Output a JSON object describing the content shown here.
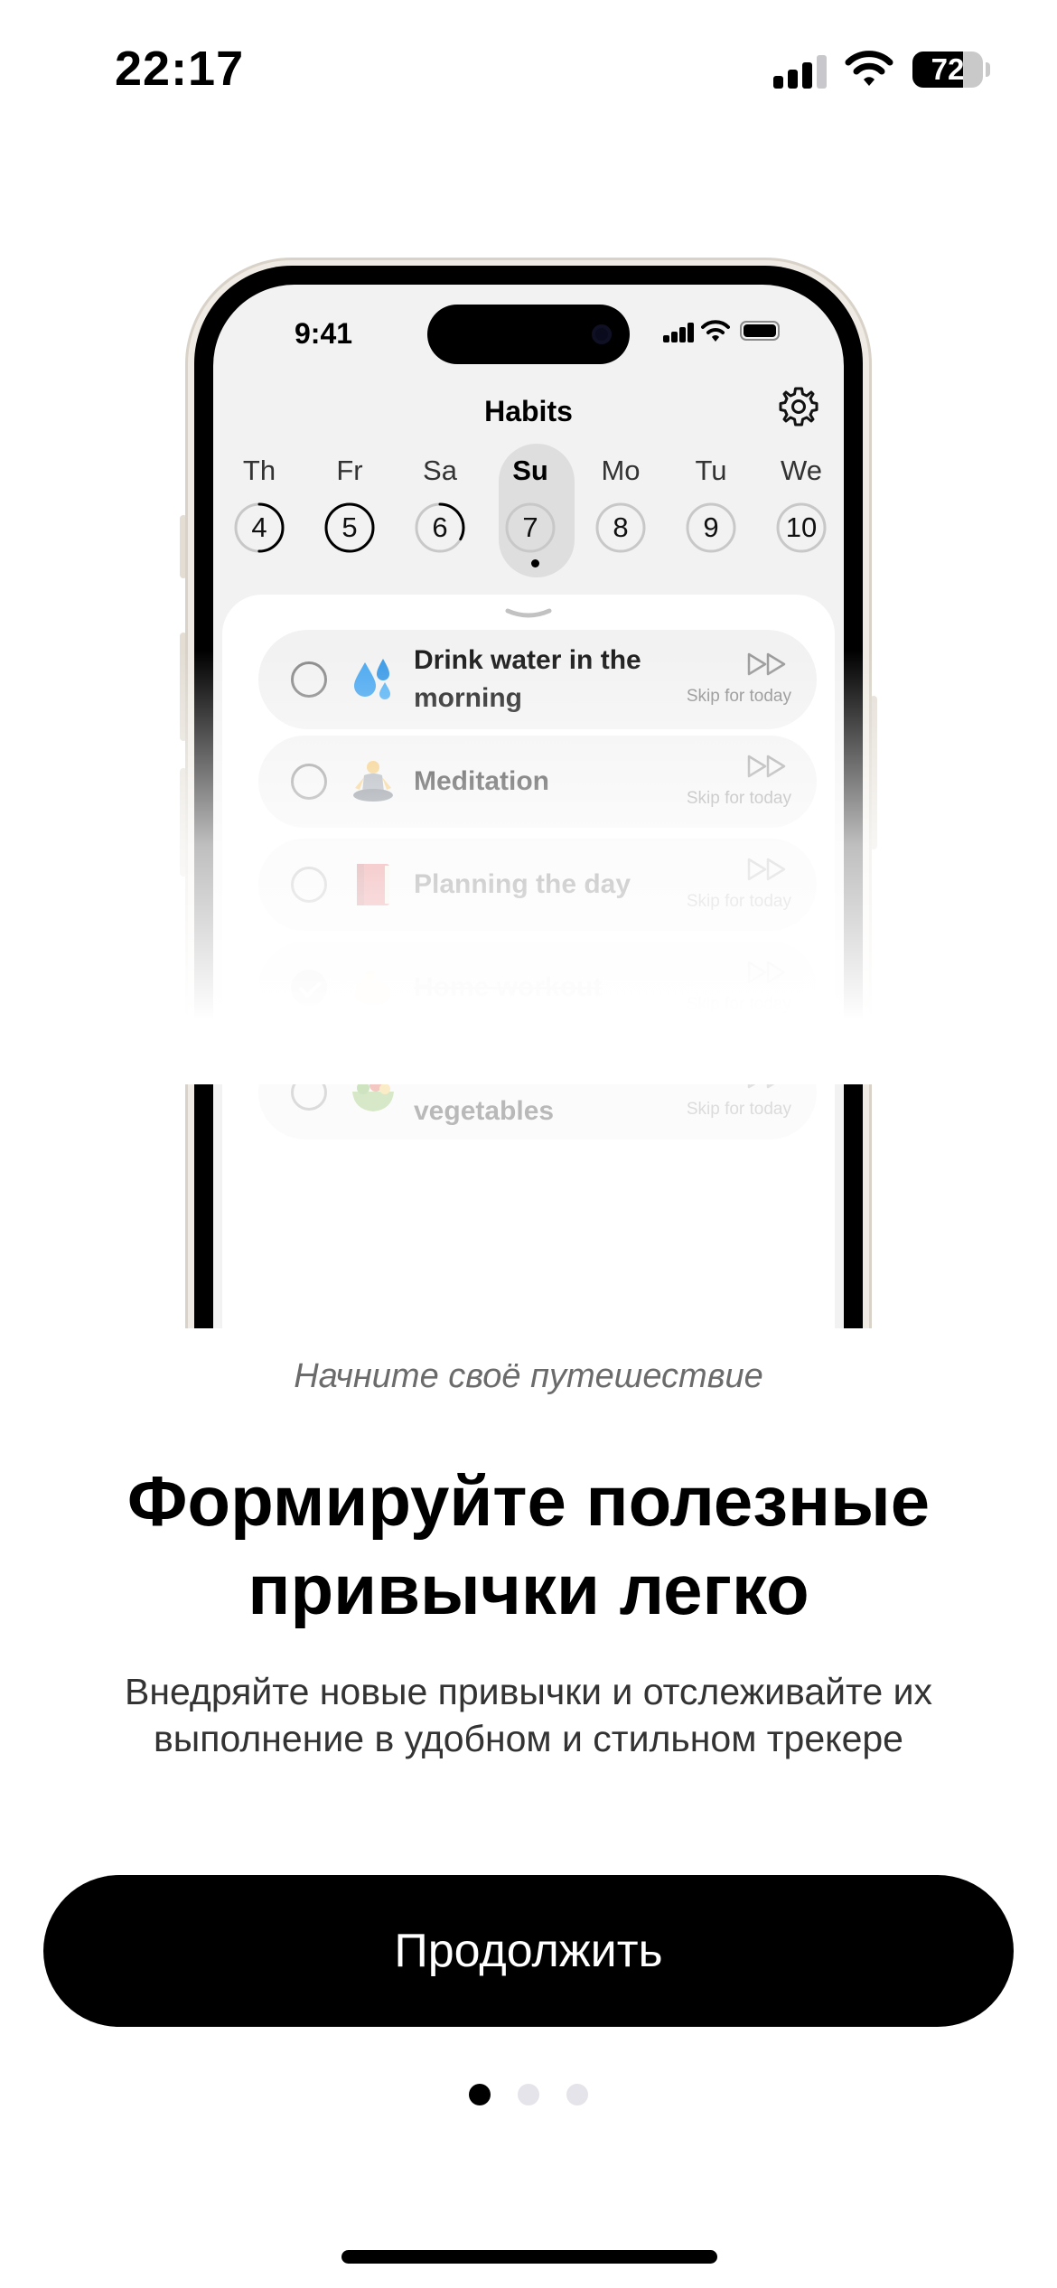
{
  "status_bar": {
    "time": "22:17",
    "battery": "72",
    "battery_level": 0.72
  },
  "phone_mockup": {
    "status_time": "9:41",
    "screen_title": "Habits",
    "days": [
      {
        "name": "Th",
        "number": "4",
        "progress": 0.5,
        "selected": false
      },
      {
        "name": "Fr",
        "number": "5",
        "progress": 1.0,
        "selected": false
      },
      {
        "name": "Sa",
        "number": "6",
        "progress": 0.33,
        "selected": false
      },
      {
        "name": "Su",
        "number": "7",
        "progress": 0.0,
        "selected": true
      },
      {
        "name": "Mo",
        "number": "8",
        "progress": 0.0,
        "selected": false
      },
      {
        "name": "Tu",
        "number": "9",
        "progress": 0.0,
        "selected": false
      },
      {
        "name": "We",
        "number": "10",
        "progress": 0.0,
        "selected": false
      }
    ],
    "skip_label": "Skip for today",
    "habits": [
      {
        "title": "Drink water in the morning",
        "emoji": "droplets",
        "done": false
      },
      {
        "title": "Meditation",
        "emoji": "meditation",
        "done": false
      },
      {
        "title": "Planning the day",
        "emoji": "red-book",
        "done": false
      },
      {
        "title": "Home workout",
        "emoji": "flexed-biceps",
        "done": true
      },
      {
        "title": "Eat more fruits and vegetables",
        "emoji": "salad",
        "done": false
      }
    ]
  },
  "onboarding": {
    "subtitle": "Начните своё путешествие",
    "headline": "Формируйте полезные привычки легко",
    "description": "Внедряйте новые привычки и отслеживайте их выполнение в удобном и стильном трекере",
    "continue_label": "Продолжить",
    "page_count": 3,
    "current_page": 1
  },
  "colors": {
    "accent": "#000000",
    "button_text": "#ffffff",
    "inactive_dot": "#e4e4ea"
  }
}
